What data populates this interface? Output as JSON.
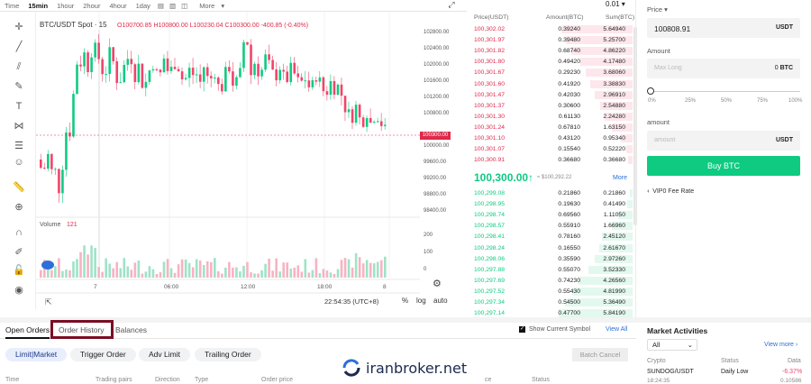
{
  "toolbar": {
    "time_label": "Time",
    "intervals": [
      "15min",
      "1hour",
      "2hour",
      "4hour",
      "1day"
    ],
    "active_interval": "15min",
    "more_label": "More"
  },
  "chart": {
    "title": "BTC/USDT Spot · 15",
    "ohlc": "O100700.85 H100800.00 L100230.04 C100300.00 -400.85 (-0.40%)",
    "volume_label": "Volume",
    "volume_value": "121",
    "last_price_tag": "100300.00",
    "price_ticks": [
      "102800.00",
      "102400.00",
      "102000.00",
      "101600.00",
      "101200.00",
      "100800.00",
      "100000.00",
      "99600.00",
      "99200.00",
      "98800.00",
      "98400.00"
    ],
    "volume_ticks": [
      "200",
      "100",
      "0"
    ],
    "time_ticks": [
      "7",
      "06:00",
      "12:00",
      "18:00",
      "8"
    ],
    "clock": "22:54:35 (UTC+8)",
    "pct_label": "%",
    "log_label": "log",
    "auto_label": "auto"
  },
  "orderbook": {
    "precision": "0.01",
    "headers": {
      "price": "Price(USDT)",
      "amount": "Amount(BTC)",
      "sum": "Sum(BTC)"
    },
    "asks": [
      [
        "100,302.02",
        "0.39240",
        "5.64940"
      ],
      [
        "100,301.97",
        "0.39480",
        "5.25700"
      ],
      [
        "100,301.82",
        "0.68740",
        "4.86220"
      ],
      [
        "100,301.80",
        "0.49420",
        "4.17480"
      ],
      [
        "100,301.67",
        "0.29230",
        "3.68060"
      ],
      [
        "100,301.60",
        "0.41920",
        "3.38830"
      ],
      [
        "100,301.47",
        "0.42030",
        "2.96910"
      ],
      [
        "100,301.37",
        "0.30600",
        "2.54880"
      ],
      [
        "100,301.30",
        "0.61130",
        "2.24280"
      ],
      [
        "100,301.24",
        "0.67810",
        "1.63150"
      ],
      [
        "100,301.10",
        "0.43120",
        "0.95340"
      ],
      [
        "100,301.07",
        "0.15540",
        "0.52220"
      ],
      [
        "100,300.91",
        "0.36680",
        "0.36680"
      ]
    ],
    "mid_price": "100,300.00↑",
    "mid_usd": "≈ $100,292.22",
    "more_label": "More",
    "bids": [
      [
        "100,299.08",
        "0.21860",
        "0.21860"
      ],
      [
        "100,298.95",
        "0.19630",
        "0.41490"
      ],
      [
        "100,298.74",
        "0.69560",
        "1.11050"
      ],
      [
        "100,298.57",
        "0.55910",
        "1.66960"
      ],
      [
        "100,298.41",
        "0.78160",
        "2.45120"
      ],
      [
        "100,298.24",
        "0.16550",
        "2.61670"
      ],
      [
        "100,298.06",
        "0.35590",
        "2.97260"
      ],
      [
        "100,297.88",
        "0.55070",
        "3.52330"
      ],
      [
        "100,297.69",
        "0.74230",
        "4.26560"
      ],
      [
        "100,297.52",
        "0.55430",
        "4.81990"
      ],
      [
        "100,297.34",
        "0.54500",
        "5.36490"
      ],
      [
        "100,297.14",
        "0.47700",
        "5.84190"
      ]
    ]
  },
  "trade": {
    "price_label": "Price",
    "price_value": "100808.91",
    "price_unit": "USDT",
    "max_label": "Max Long",
    "max_value": "0",
    "max_unit": "BTC",
    "slider_marks": [
      "0%",
      "25%",
      "50%",
      "75%",
      "100%"
    ],
    "amount_label": "amount",
    "amount_placeholder": "amount",
    "amount_unit": "USDT",
    "buy_label": "Buy BTC",
    "vip_label": "VIP0 Fee Rate"
  },
  "orders": {
    "tabs": [
      "Open Orders",
      "Order History",
      "Balances"
    ],
    "show_symbol_label": "Show Current Symbol",
    "view_all": "View All",
    "types": [
      "Limit|Market",
      "Trigger Order",
      "Adv Limit",
      "Trailing Order"
    ],
    "batch_cancel": "Batch Cancel",
    "columns": [
      "Time",
      "Trading pairs",
      "Direction",
      "Type",
      "Order price",
      "ce",
      "Status"
    ]
  },
  "brand": {
    "name": "iranbroker.net"
  },
  "market": {
    "title": "Market Activities",
    "filter": "All",
    "view_more": "View more",
    "columns": [
      "Crypto",
      "Status",
      "Data"
    ],
    "row": {
      "symbol": "SUNDOG/USDT",
      "status": "Daily Low",
      "change": "-6.37%",
      "time": "18:24:35",
      "value": "0.10586"
    }
  },
  "colors": {
    "up": "#0ecb81",
    "down": "#f0456a",
    "accent": "#2c6fd8",
    "highlight": "#7a0e24"
  }
}
